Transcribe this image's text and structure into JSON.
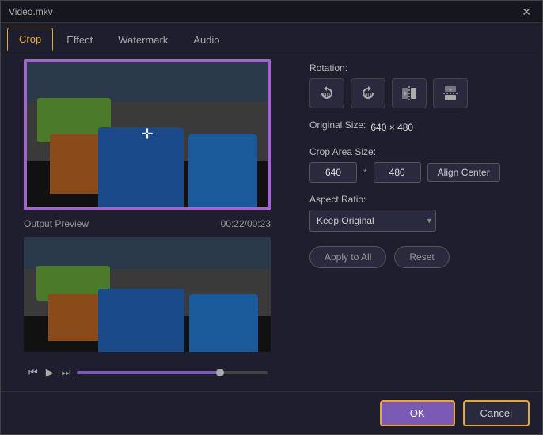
{
  "window": {
    "title": "Video.mkv",
    "close_btn": "✕"
  },
  "tabs": [
    {
      "id": "crop",
      "label": "Crop",
      "active": true
    },
    {
      "id": "effect",
      "label": "Effect",
      "active": false
    },
    {
      "id": "watermark",
      "label": "Watermark",
      "active": false
    },
    {
      "id": "audio",
      "label": "Audio",
      "active": false
    }
  ],
  "right_panel": {
    "rotation_label": "Rotation:",
    "original_size_label": "Original Size:",
    "original_size_value": "640 × 480",
    "crop_area_label": "Crop Area Size:",
    "crop_width": "640",
    "crop_height": "480",
    "crop_sep": "*",
    "align_center_label": "Align Center",
    "aspect_label": "Aspect Ratio:",
    "aspect_value": "Keep Original",
    "apply_all_label": "Apply to All",
    "reset_label": "Reset"
  },
  "rotation_buttons": [
    {
      "id": "rot-left",
      "icon": "↺",
      "title": "Rotate Left 90°"
    },
    {
      "id": "rot-right",
      "icon": "↻",
      "title": "Rotate Right 90°"
    },
    {
      "id": "flip-h",
      "icon": "⇔",
      "title": "Flip Horizontal"
    },
    {
      "id": "flip-v",
      "icon": "⇕",
      "title": "Flip Vertical"
    }
  ],
  "output_preview": {
    "label": "Output Preview",
    "time": "00:22/00:23"
  },
  "playback": {
    "prev_btn": "⏮",
    "play_btn": "▶",
    "next_btn": "⏭",
    "progress_percent": 75
  },
  "footer": {
    "ok_label": "OK",
    "cancel_label": "Cancel"
  }
}
